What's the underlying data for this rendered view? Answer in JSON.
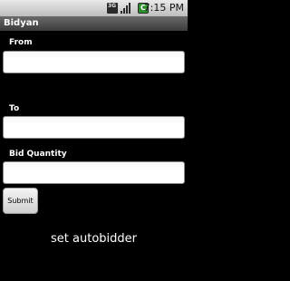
{
  "status_bar": {
    "network_badge": "3G",
    "battery_badge": "C",
    "time": "7:15 PM"
  },
  "app": {
    "title": "Bidyan"
  },
  "form": {
    "from_label": "From",
    "from_value": "",
    "to_label": "To",
    "to_value": "",
    "bid_quantity_label": "Bid Quantity",
    "bid_quantity_value": "",
    "submit_label": "Submit"
  },
  "footer": {
    "autobidder_text": "set autobidder"
  },
  "colors": {
    "background": "#000000",
    "title_bar": "#4a4a4a",
    "status_bar": "#d3d3d3"
  }
}
